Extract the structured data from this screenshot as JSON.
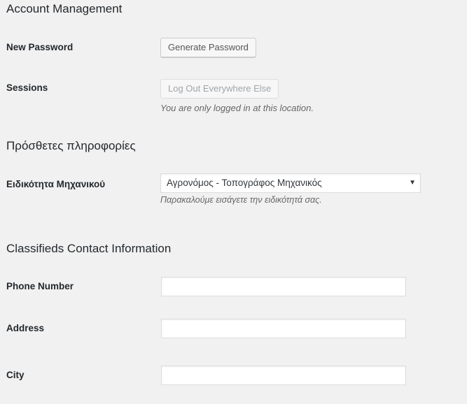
{
  "account_management": {
    "heading": "Account Management",
    "new_password": {
      "label": "New Password",
      "button": "Generate Password"
    },
    "sessions": {
      "label": "Sessions",
      "button": "Log Out Everywhere Else",
      "description": "You are only logged in at this location."
    }
  },
  "additional_info": {
    "heading": "Πρόσθετες πληροφορίες",
    "specialty": {
      "label": "Ειδικότητα Μηχανικού",
      "selected": "Αγρονόμος - Τοπογράφος Μηχανικός",
      "arrow_icon": "▼",
      "description": "Παρακαλούμε εισάγετε την ειδικότητά σας."
    }
  },
  "classifieds": {
    "heading": "Classifieds Contact Information",
    "phone": {
      "label": "Phone Number",
      "value": ""
    },
    "address": {
      "label": "Address",
      "value": ""
    },
    "city": {
      "label": "City",
      "value": ""
    }
  }
}
